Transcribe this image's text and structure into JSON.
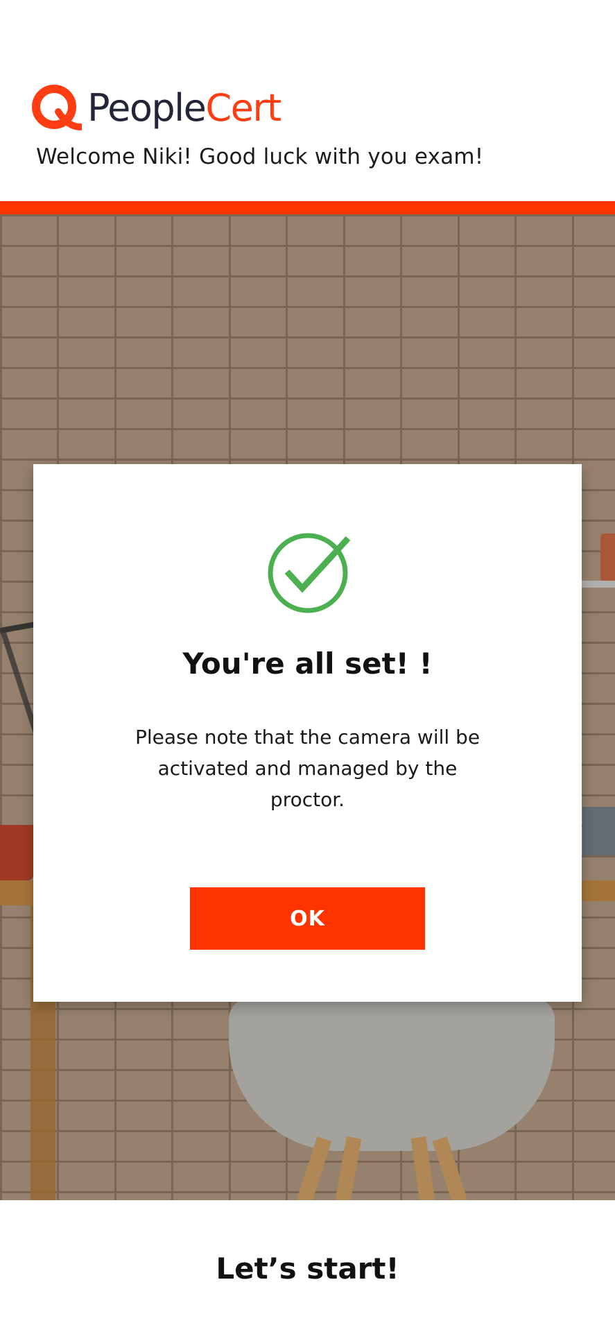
{
  "header": {
    "logo": {
      "text_part1": "People",
      "text_part2": "Cert",
      "brand_dark": "#222638",
      "brand_accent": "#ff3d12"
    },
    "welcome": "Welcome Niki! Good luck with you exam!"
  },
  "accent_color": "#ff3300",
  "modal": {
    "icon": "check-circle-icon",
    "icon_color": "#4caf50",
    "title": "You're all set! !",
    "body": "Please note that the camera will be activated and managed by the proctor.",
    "ok_label": "OK"
  },
  "footer": {
    "heading": "Let’s start!"
  }
}
